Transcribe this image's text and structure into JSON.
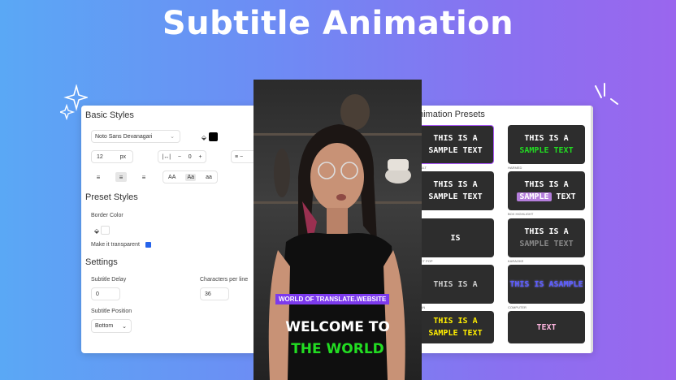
{
  "hero": {
    "title": "Subtitle Animation"
  },
  "colors": {
    "accent": "#7c3aed",
    "green": "#22dd22",
    "tile_bg": "#2d2d2d"
  },
  "left_panel": {
    "basic_styles": {
      "title": "Basic Styles",
      "font": "Noto Sans Devanagari",
      "font_size": "12",
      "font_unit": "px",
      "spacing_value": "0",
      "case_options": [
        "AA",
        "Aa",
        "aa"
      ]
    },
    "preset_styles": {
      "title": "Preset Styles",
      "border_color_label": "Border Color",
      "transparent_label": "Make it transparent"
    },
    "settings": {
      "title": "Settings",
      "delay_label": "Subtitle Delay",
      "delay_value": "0",
      "chars_label": "Characters per line",
      "chars_value": "36",
      "position_label": "Subtitle Position",
      "position_value": "Bottom"
    }
  },
  "video": {
    "banner": "WORLD OF TRANSLATE.WEBSITE",
    "line1": "WELCOME TO",
    "line2": "THE WORLD"
  },
  "right_panel": {
    "title": "nimation Presets",
    "presets": [
      {
        "text": "THIS IS A SAMPLE TEXT",
        "label": "AULT"
      },
      {
        "text_a": "THIS IS A",
        "text_b": "SAMPLE TEXT",
        "label": "HARMED"
      },
      {
        "text": "THIS IS A SAMPLE TEXT",
        "label": "E"
      },
      {
        "text_a": "THIS IS A",
        "text_b": "SAMPLE",
        "text_c": "TEXT",
        "label": "BOX HIGHLIGHT"
      },
      {
        "text": "IS",
        "label": "ACT POP"
      },
      {
        "text_a": "THIS IS A",
        "text_b": "SAMPLE TEXT",
        "label": "KARAOKE"
      },
      {
        "text": "THIS IS A",
        "label": "BAN"
      },
      {
        "text": "THIS IS ASAMPLE",
        "label": "COMPUTER"
      },
      {
        "text": "THIS IS A SAMPLE TEXT",
        "label": ""
      },
      {
        "text": "TEXT",
        "label": ""
      }
    ]
  }
}
